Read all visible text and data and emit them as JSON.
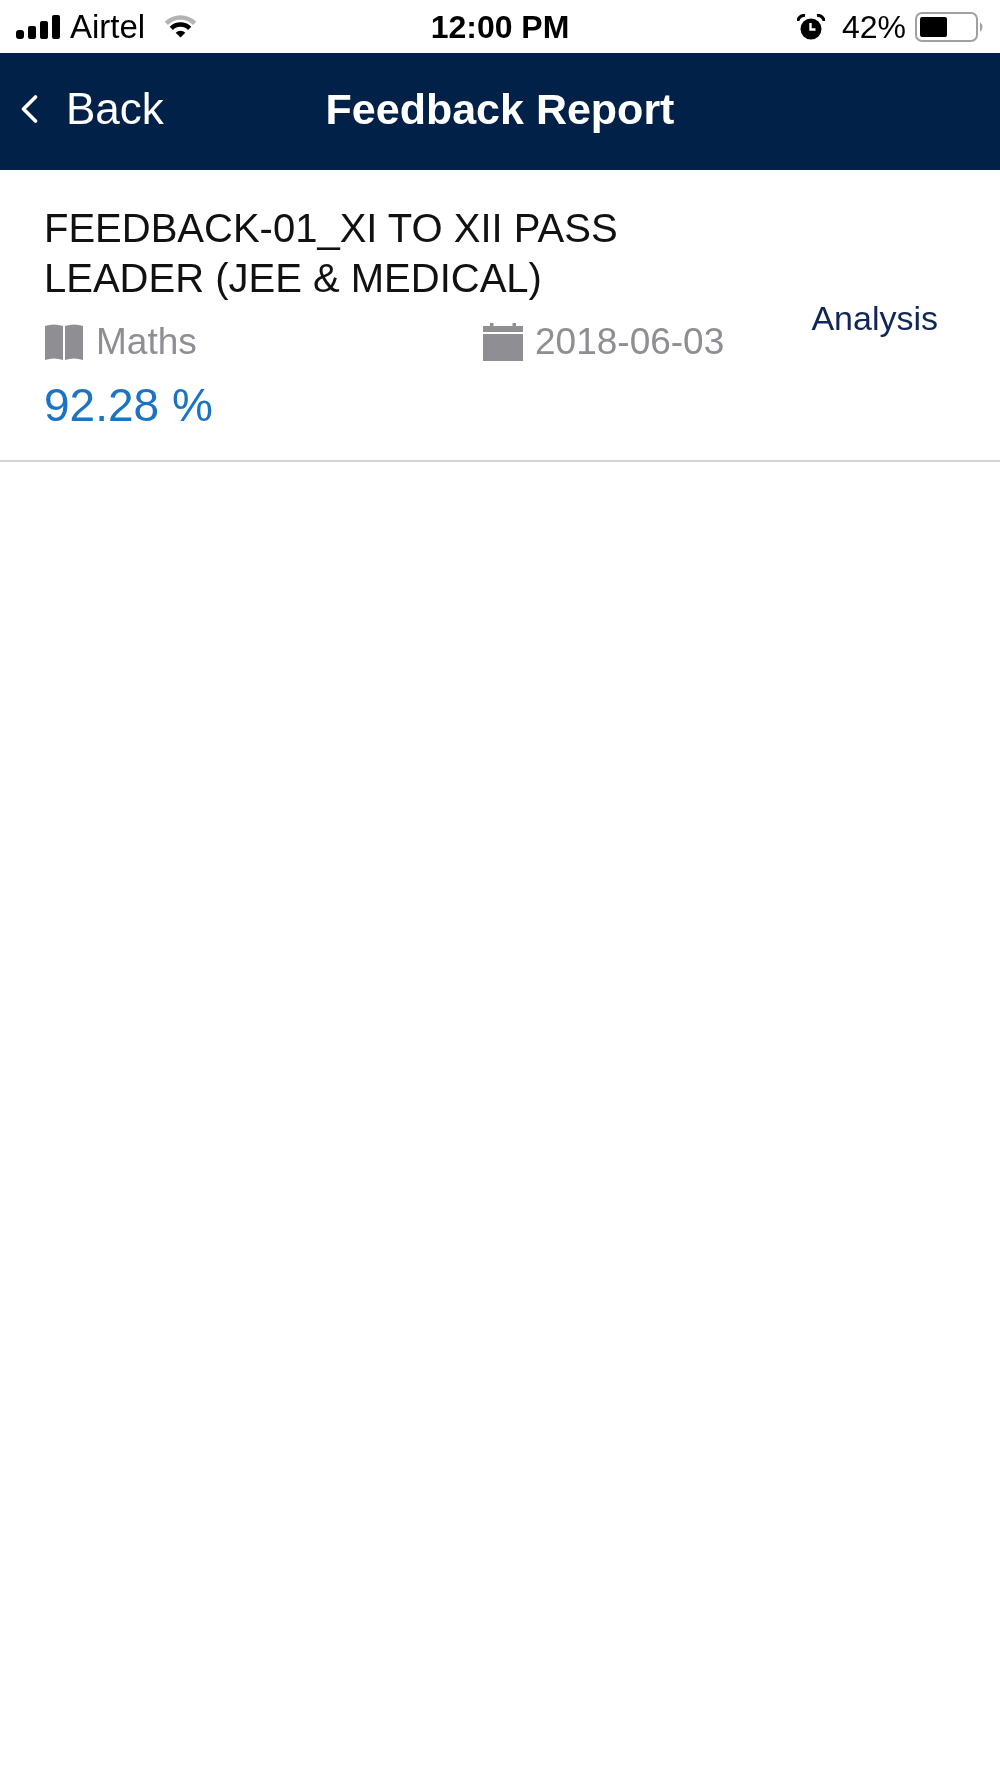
{
  "status_bar": {
    "carrier": "Airtel",
    "time": "12:00 PM",
    "battery": "42%"
  },
  "nav_bar": {
    "back": "Back",
    "title": "Feedback Report"
  },
  "reports": [
    {
      "title": "FEEDBACK-01_XI TO XII PASS LEADER (JEE & MEDICAL)",
      "subject": "Maths",
      "date": "2018-06-03",
      "score": "92.28 %",
      "action": "Analysis"
    }
  ]
}
